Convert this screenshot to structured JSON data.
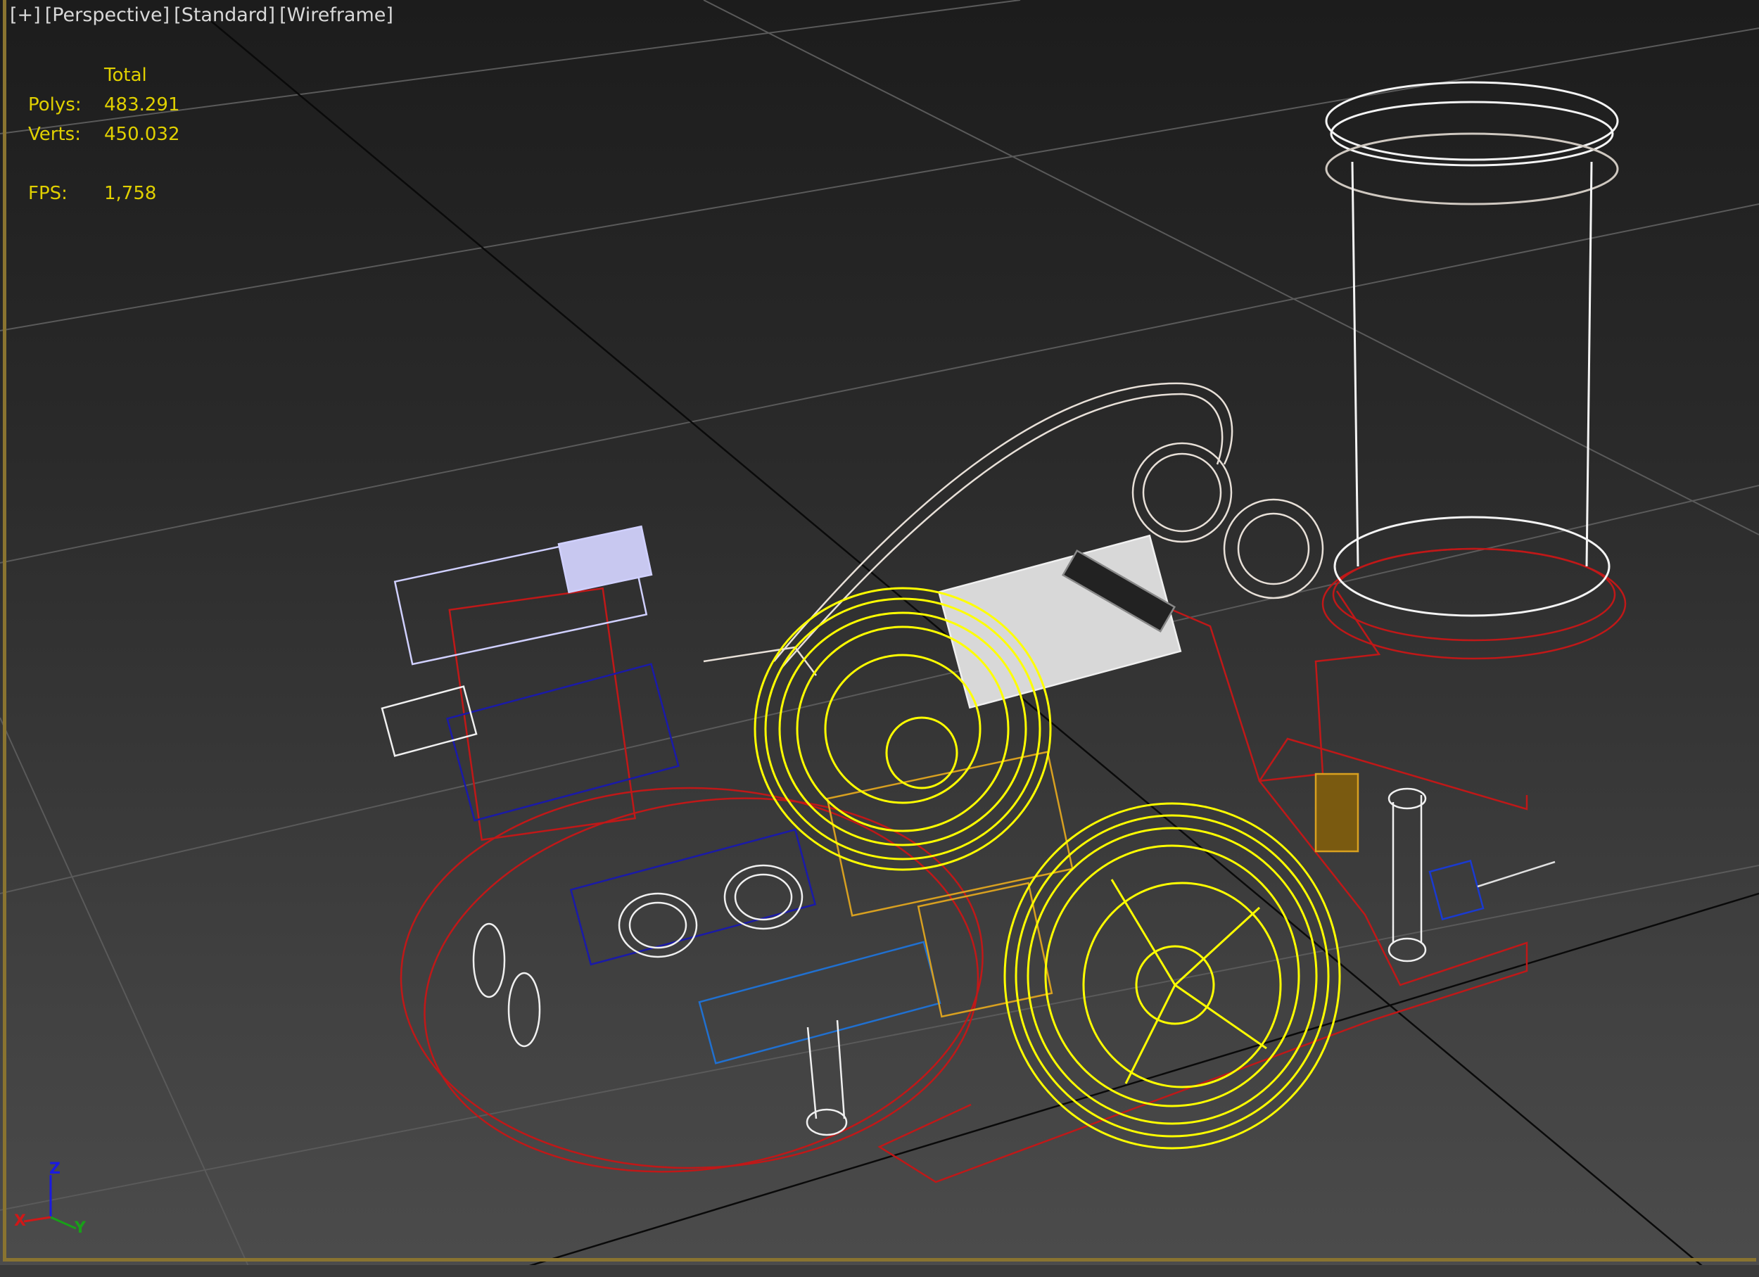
{
  "viewport": {
    "menu_plus": "[+]",
    "view_label": "[Perspective]",
    "shading_label": "[Standard]",
    "display_mode_label": "[Wireframe]"
  },
  "stats": {
    "header": "Total",
    "polys_label": "Polys:",
    "polys_value": "483.291",
    "verts_label": "Verts:",
    "verts_value": "450.032",
    "fps_label": "FPS:",
    "fps_value": "1,758"
  },
  "axis_gizmo": {
    "x": "X",
    "y": "Y",
    "z": "Z"
  },
  "colors": {
    "selection_yellow": "#ffff00",
    "wire_red": "#c01818",
    "wire_white": "#f0f0f0",
    "wire_blue": "#1a1aa8",
    "wire_orange": "#d8a020",
    "frame_gold": "#8a7430",
    "stats_text": "#e0d000"
  }
}
